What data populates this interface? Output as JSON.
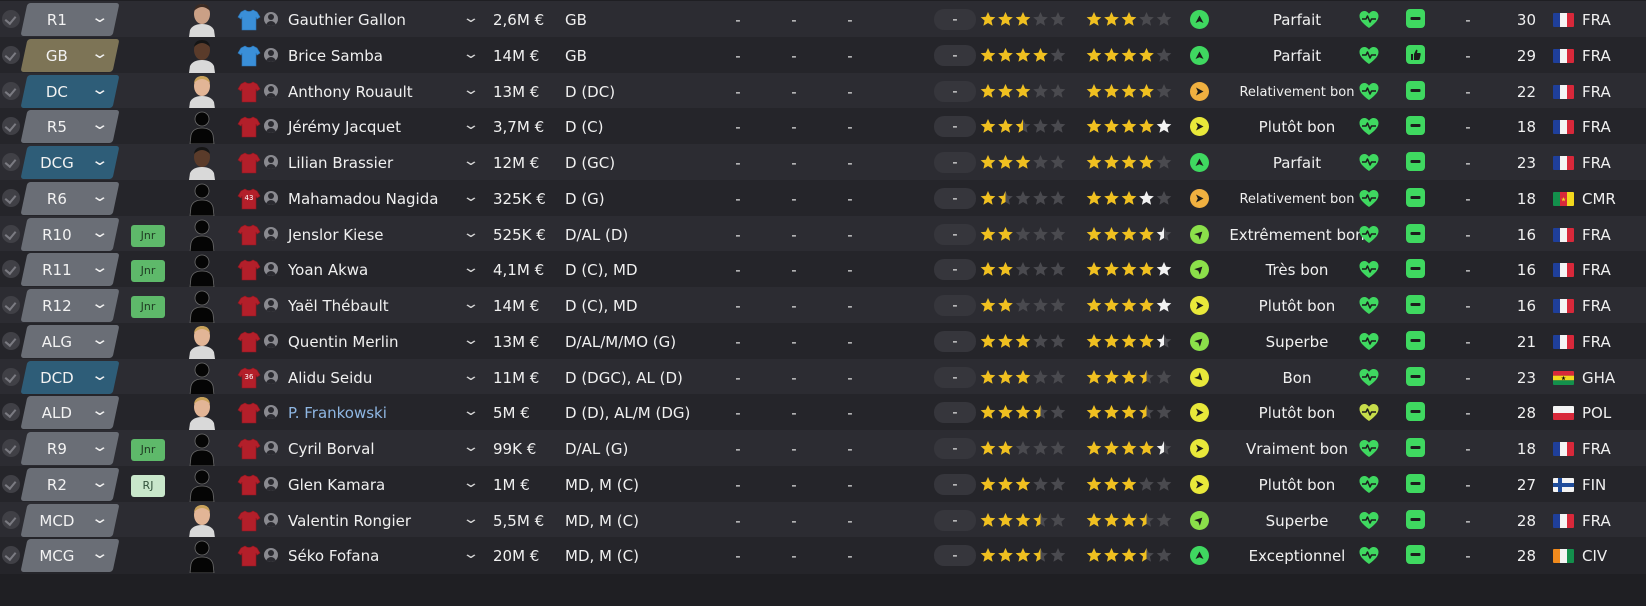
{
  "colors": {
    "pos_gk": "#7d7456",
    "pos_def": "#2e5d78",
    "pos_generic": "#6a6e76",
    "star_gold": "#f0c020",
    "star_white": "#f2f2f2",
    "star_empty": "#4a4a4f",
    "badge_jnr": "#5eb96a",
    "heart_green": "#3fd860"
  },
  "columns": {
    "dash_placeholder": "-"
  },
  "players": [
    {
      "pos": "R1",
      "pos_style": "generic",
      "badge": "",
      "face": "face",
      "kit": "blue",
      "kit_number": "",
      "name": "Gauthier Gallon",
      "link": false,
      "value": "2,6M €",
      "position": "GB",
      "dashes": [
        "-",
        "-",
        "-"
      ],
      "pill": "-",
      "cur_ability": 3,
      "cur_white": 0,
      "pot_ability": 3,
      "pot_white": 0,
      "morale": "up",
      "morale_text": "Parfait",
      "heart": "full",
      "happiness": "empty",
      "dash2": "-",
      "age": "30",
      "flag": "fr",
      "nation": "FRA"
    },
    {
      "pos": "GB",
      "pos_style": "gk",
      "badge": "",
      "face": "face-dark",
      "kit": "blue",
      "kit_number": "",
      "name": "Brice Samba",
      "link": false,
      "value": "14M €",
      "position": "GB",
      "dashes": [
        "-",
        "-",
        "-"
      ],
      "pill": "-",
      "cur_ability": 4,
      "cur_white": 0,
      "pot_ability": 4,
      "pot_white": 0,
      "morale": "up",
      "morale_text": "Parfait",
      "heart": "full",
      "happiness": "thumb",
      "dash2": "-",
      "age": "29",
      "flag": "fr",
      "nation": "FRA"
    },
    {
      "pos": "DC",
      "pos_style": "def",
      "badge": "",
      "face": "face-light",
      "kit": "red",
      "kit_number": "",
      "name": "Anthony Rouault",
      "link": false,
      "value": "13M €",
      "position": "D (DC)",
      "dashes": [
        "-",
        "-",
        "-"
      ],
      "pill": "-",
      "cur_ability": 3,
      "cur_white": 0,
      "pot_ability": 4,
      "pot_white": 0,
      "morale": "right-orange",
      "morale_text": "Relativement bon",
      "heart": "full",
      "happiness": "minus",
      "dash2": "-",
      "age": "22",
      "flag": "fr",
      "nation": "FRA"
    },
    {
      "pos": "R5",
      "pos_style": "generic",
      "badge": "",
      "face": "silhouette",
      "kit": "red",
      "kit_number": "",
      "name": "Jérémy Jacquet",
      "link": false,
      "value": "3,7M €",
      "position": "D (C)",
      "dashes": [
        "-",
        "-",
        "-"
      ],
      "pill": "-",
      "cur_ability": 2.5,
      "cur_white": 0,
      "pot_ability": 4,
      "pot_white": 1,
      "morale": "right-yellow",
      "morale_text": "Plutôt bon",
      "heart": "full",
      "happiness": "minus",
      "dash2": "-",
      "age": "18",
      "flag": "fr",
      "nation": "FRA"
    },
    {
      "pos": "DCG",
      "pos_style": "def",
      "badge": "",
      "face": "face-dark",
      "kit": "red",
      "kit_number": "",
      "name": "Lilian Brassier",
      "link": false,
      "value": "12M €",
      "position": "D (GC)",
      "dashes": [
        "-",
        "-",
        "-"
      ],
      "pill": "-",
      "cur_ability": 3,
      "cur_white": 0,
      "pot_ability": 4,
      "pot_white": 0,
      "morale": "up",
      "morale_text": "Parfait",
      "heart": "full",
      "happiness": "minus",
      "dash2": "-",
      "age": "23",
      "flag": "fr",
      "nation": "FRA"
    },
    {
      "pos": "R6",
      "pos_style": "generic",
      "badge": "",
      "face": "silhouette",
      "kit": "red",
      "kit_number": "43",
      "name": "Mahamadou Nagida",
      "link": false,
      "value": "325K €",
      "position": "D (G)",
      "dashes": [
        "-",
        "-",
        "-"
      ],
      "pill": "-",
      "cur_ability": 1.5,
      "cur_white": 0,
      "pot_ability": 3,
      "pot_white": 1,
      "morale": "right-orange",
      "morale_text": "Relativement bon",
      "heart": "full",
      "happiness": "minus",
      "dash2": "-",
      "age": "18",
      "flag": "cm",
      "nation": "CMR"
    },
    {
      "pos": "R10",
      "pos_style": "generic",
      "badge": "Jnr",
      "face": "silhouette",
      "kit": "red",
      "kit_number": "",
      "name": "Jenslor Kiese",
      "link": false,
      "value": "525K €",
      "position": "D/AL (D)",
      "dashes": [
        "-",
        "-",
        "-"
      ],
      "pill": "-",
      "cur_ability": 2,
      "cur_white": 0,
      "pot_ability": 4,
      "pot_white": 0.5,
      "morale": "upright",
      "morale_text": "Extrêmement bon",
      "heart": "full",
      "happiness": "minus",
      "dash2": "-",
      "age": "16",
      "flag": "fr",
      "nation": "FRA"
    },
    {
      "pos": "R11",
      "pos_style": "generic",
      "badge": "Jnr",
      "face": "silhouette",
      "kit": "red",
      "kit_number": "",
      "name": "Yoan Akwa",
      "link": false,
      "value": "4,1M €",
      "position": "D (C), MD",
      "dashes": [
        "-",
        "-",
        "-"
      ],
      "pill": "-",
      "cur_ability": 2,
      "cur_white": 0,
      "pot_ability": 4,
      "pot_white": 1,
      "morale": "upright",
      "morale_text": "Très bon",
      "heart": "full",
      "happiness": "minus",
      "dash2": "-",
      "age": "16",
      "flag": "fr",
      "nation": "FRA"
    },
    {
      "pos": "R12",
      "pos_style": "generic",
      "badge": "Jnr",
      "face": "silhouette",
      "kit": "red",
      "kit_number": "",
      "name": "Yaël Thébault",
      "link": false,
      "value": "14M €",
      "position": "D (C), MD",
      "dashes": [
        "-",
        "-",
        "-"
      ],
      "pill": "-",
      "cur_ability": 2,
      "cur_white": 0,
      "pot_ability": 4,
      "pot_white": 1,
      "morale": "right-yellow",
      "morale_text": "Plutôt bon",
      "heart": "full",
      "happiness": "minus",
      "dash2": "-",
      "age": "16",
      "flag": "fr",
      "nation": "FRA"
    },
    {
      "pos": "ALG",
      "pos_style": "generic",
      "badge": "",
      "face": "face-light",
      "kit": "red",
      "kit_number": "",
      "name": "Quentin Merlin",
      "link": false,
      "value": "13M €",
      "position": "D/AL/M/MO (G)",
      "dashes": [
        "-",
        "-",
        "-"
      ],
      "pill": "-",
      "cur_ability": 3,
      "cur_white": 0,
      "pot_ability": 4,
      "pot_white": 0.5,
      "morale": "upright",
      "morale_text": "Superbe",
      "heart": "full",
      "happiness": "minus",
      "dash2": "-",
      "age": "21",
      "flag": "fr",
      "nation": "FRA"
    },
    {
      "pos": "DCD",
      "pos_style": "def",
      "badge": "",
      "face": "silhouette",
      "kit": "red",
      "kit_number": "36",
      "name": "Alidu Seidu",
      "link": false,
      "value": "11M €",
      "position": "D (DGC), AL (D)",
      "dashes": [
        "-",
        "-",
        "-"
      ],
      "pill": "-",
      "cur_ability": 3,
      "cur_white": 0,
      "pot_ability": 3.5,
      "pot_white": 0,
      "morale": "downright",
      "morale_text": "Bon",
      "heart": "full",
      "happiness": "minus",
      "dash2": "-",
      "age": "23",
      "flag": "gh",
      "nation": "GHA"
    },
    {
      "pos": "ALD",
      "pos_style": "generic",
      "badge": "",
      "face": "face-light",
      "kit": "red",
      "kit_number": "",
      "name": "P. Frankowski",
      "link": true,
      "value": "5M €",
      "position": "D (D), AL/M (DG)",
      "dashes": [
        "-",
        "-",
        "-"
      ],
      "pill": "-",
      "cur_ability": 3.5,
      "cur_white": 0,
      "pot_ability": 3.5,
      "pot_white": 0,
      "morale": "right-yellow",
      "morale_text": "Plutôt bon",
      "heart": "half",
      "happiness": "minus",
      "dash2": "-",
      "age": "28",
      "flag": "pl",
      "nation": "POL"
    },
    {
      "pos": "R9",
      "pos_style": "generic",
      "badge": "Jnr",
      "face": "silhouette",
      "kit": "red",
      "kit_number": "",
      "name": "Cyril Borval",
      "link": false,
      "value": "99K €",
      "position": "D/AL (G)",
      "dashes": [
        "-",
        "-",
        "-"
      ],
      "pill": "-",
      "cur_ability": 2,
      "cur_white": 0,
      "pot_ability": 4,
      "pot_white": 0.5,
      "morale": "right-yellow",
      "morale_text": "Vraiment bon",
      "heart": "full",
      "happiness": "minus",
      "dash2": "-",
      "age": "18",
      "flag": "fr",
      "nation": "FRA"
    },
    {
      "pos": "R2",
      "pos_style": "generic",
      "badge": "RJ",
      "face": "silhouette",
      "kit": "red",
      "kit_number": "",
      "name": "Glen Kamara",
      "link": false,
      "value": "1M €",
      "position": "MD, M (C)",
      "dashes": [
        "-",
        "-",
        "-"
      ],
      "pill": "-",
      "cur_ability": 3,
      "cur_white": 0,
      "pot_ability": 3,
      "pot_white": 0,
      "morale": "right-yellow",
      "morale_text": "Plutôt bon",
      "heart": "full",
      "happiness": "minus",
      "dash2": "-",
      "age": "27",
      "flag": "fi",
      "nation": "FIN"
    },
    {
      "pos": "MCD",
      "pos_style": "generic",
      "badge": "",
      "face": "face-light",
      "kit": "red",
      "kit_number": "",
      "name": "Valentin Rongier",
      "link": false,
      "value": "5,5M €",
      "position": "MD, M (C)",
      "dashes": [
        "-",
        "-",
        "-"
      ],
      "pill": "-",
      "cur_ability": 3.5,
      "cur_white": 0,
      "pot_ability": 3.5,
      "pot_white": 0,
      "morale": "upright",
      "morale_text": "Superbe",
      "heart": "full",
      "happiness": "minus",
      "dash2": "-",
      "age": "28",
      "flag": "fr",
      "nation": "FRA"
    },
    {
      "pos": "MCG",
      "pos_style": "generic",
      "badge": "",
      "face": "silhouette",
      "kit": "red",
      "kit_number": "",
      "name": "Séko Fofana",
      "link": false,
      "value": "20M €",
      "position": "MD, M (C)",
      "dashes": [
        "-",
        "-",
        "-"
      ],
      "pill": "-",
      "cur_ability": 3.5,
      "cur_white": 0,
      "pot_ability": 3.5,
      "pot_white": 0,
      "morale": "up",
      "morale_text": "Exceptionnel",
      "heart": "full",
      "happiness": "minus",
      "dash2": "-",
      "age": "28",
      "flag": "ci",
      "nation": "CIV"
    }
  ]
}
